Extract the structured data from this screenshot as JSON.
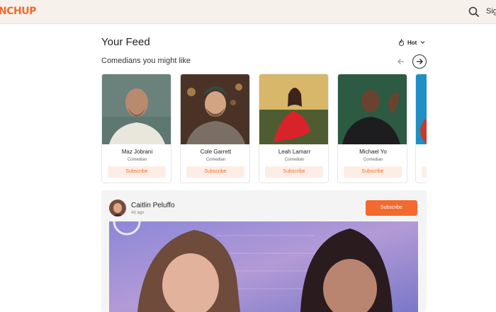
{
  "header": {
    "logo": "NCHUP",
    "signin_label": "Sig"
  },
  "feed": {
    "title": "Your Feed",
    "sort_label": "Hot"
  },
  "suggestions": {
    "title": "Comedians you might like",
    "cards": [
      {
        "name": "Maz Jobrani",
        "role": "Comedian",
        "subscribe_label": "Subscribe"
      },
      {
        "name": "Cole Garrett",
        "role": "Comedian",
        "subscribe_label": "Subscribe"
      },
      {
        "name": "Leah Lamarr",
        "role": "Comedian",
        "subscribe_label": "Subscribe"
      },
      {
        "name": "Michael Yo",
        "role": "Comedian",
        "subscribe_label": "Subscribe"
      }
    ]
  },
  "post": {
    "author": "Caitlin Peluffo",
    "time": "4d ago",
    "subscribe_label": "Subscribe"
  },
  "colors": {
    "accent": "#f26a2e",
    "accent_light": "#fdeee5",
    "header_bg": "#f6f1ea"
  },
  "icons": {
    "search": "search-icon",
    "sort": "flame-icon",
    "chevron": "chevron-down-icon",
    "prev": "arrow-left-icon",
    "next": "arrow-right-icon"
  }
}
